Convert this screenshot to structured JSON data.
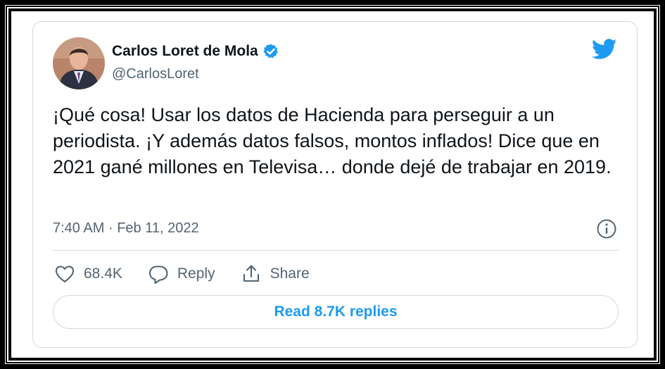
{
  "author": {
    "name": "Carlos Loret de Mola",
    "handle": "@CarlosLoret",
    "verified": true
  },
  "tweet": {
    "text": "¡Qué cosa! Usar los datos de Hacienda para perseguir a un periodista. ¡Y además datos falsos, montos inflados! Dice que en 2021 gané millones en Televisa… donde dejé de trabajar en 2019.",
    "time": "7:40 AM",
    "separator": "·",
    "date": "Feb 11, 2022"
  },
  "actions": {
    "like_count": "68.4K",
    "reply_label": "Reply",
    "share_label": "Share"
  },
  "read_replies_label": "Read 8.7K replies",
  "icons": {
    "brand": "twitter-bird-icon",
    "info": "info-icon",
    "like": "heart-icon",
    "reply": "speech-bubble-icon",
    "share": "share-arrow-icon",
    "verified": "verified-badge-icon"
  },
  "colors": {
    "accent": "#1d9bf0",
    "text": "#0f1419",
    "secondary": "#536471",
    "border": "#cfd9de"
  }
}
